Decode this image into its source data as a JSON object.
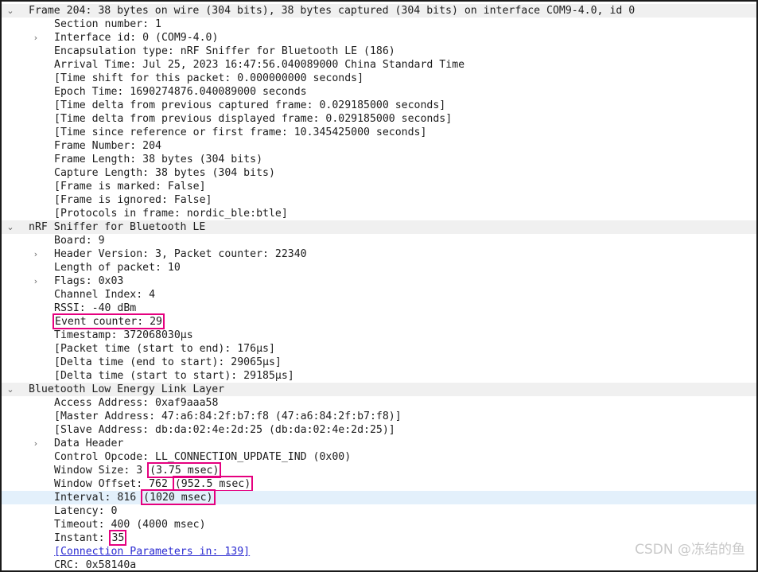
{
  "window": {
    "title": "Wireshark packet details pane"
  },
  "icons": {
    "expanded": "⌄",
    "collapsed": "›"
  },
  "watermark": "CSDN @冻结的鱼",
  "colors": {
    "annotation": "#e5007f",
    "selected_row": "#e3f0fb",
    "protocol_row": "#f0f0f0",
    "link": "#2b2bd1",
    "text": "#1c1c1c"
  },
  "rows": [
    {
      "text": "Frame 204: 38 bytes on wire (304 bits), 38 bytes captured (304 bits) on interface COM9-4.0, id 0",
      "level": 0,
      "twisty": "expanded",
      "style": "protocol",
      "name": "tree-row-frame"
    },
    {
      "text": "Section number: 1",
      "level": 1,
      "twisty": "none",
      "style": "normal",
      "name": "tree-row-section-number"
    },
    {
      "text": "Interface id: 0 (COM9-4.0)",
      "level": 1,
      "twisty": "collapsed",
      "style": "normal",
      "name": "tree-row-interface-id"
    },
    {
      "text": "Encapsulation type: nRF Sniffer for Bluetooth LE (186)",
      "level": 1,
      "twisty": "none",
      "style": "normal",
      "name": "tree-row-encapsulation-type"
    },
    {
      "text": "Arrival Time: Jul 25, 2023 16:47:56.040089000 China Standard Time",
      "level": 1,
      "twisty": "none",
      "style": "normal",
      "name": "tree-row-arrival-time"
    },
    {
      "text": "[Time shift for this packet: 0.000000000 seconds]",
      "level": 1,
      "twisty": "none",
      "style": "normal",
      "name": "tree-row-time-shift"
    },
    {
      "text": "Epoch Time: 1690274876.040089000 seconds",
      "level": 1,
      "twisty": "none",
      "style": "normal",
      "name": "tree-row-epoch-time"
    },
    {
      "text": "[Time delta from previous captured frame: 0.029185000 seconds]",
      "level": 1,
      "twisty": "none",
      "style": "normal",
      "name": "tree-row-time-delta-captured"
    },
    {
      "text": "[Time delta from previous displayed frame: 0.029185000 seconds]",
      "level": 1,
      "twisty": "none",
      "style": "normal",
      "name": "tree-row-time-delta-displayed"
    },
    {
      "text": "[Time since reference or first frame: 10.345425000 seconds]",
      "level": 1,
      "twisty": "none",
      "style": "normal",
      "name": "tree-row-time-since-reference"
    },
    {
      "text": "Frame Number: 204",
      "level": 1,
      "twisty": "none",
      "style": "normal",
      "name": "tree-row-frame-number"
    },
    {
      "text": "Frame Length: 38 bytes (304 bits)",
      "level": 1,
      "twisty": "none",
      "style": "normal",
      "name": "tree-row-frame-length"
    },
    {
      "text": "Capture Length: 38 bytes (304 bits)",
      "level": 1,
      "twisty": "none",
      "style": "normal",
      "name": "tree-row-capture-length"
    },
    {
      "text": "[Frame is marked: False]",
      "level": 1,
      "twisty": "none",
      "style": "normal",
      "name": "tree-row-frame-is-marked"
    },
    {
      "text": "[Frame is ignored: False]",
      "level": 1,
      "twisty": "none",
      "style": "normal",
      "name": "tree-row-frame-is-ignored"
    },
    {
      "text": "[Protocols in frame: nordic_ble:btle]",
      "level": 1,
      "twisty": "none",
      "style": "normal",
      "name": "tree-row-protocols-in-frame"
    },
    {
      "text": "nRF Sniffer for Bluetooth LE",
      "level": 0,
      "twisty": "expanded",
      "style": "protocol",
      "name": "tree-row-nrf-sniffer"
    },
    {
      "text": "Board: 9",
      "level": 1,
      "twisty": "none",
      "style": "normal",
      "name": "tree-row-board"
    },
    {
      "text": "Header Version: 3, Packet counter: 22340",
      "level": 1,
      "twisty": "collapsed",
      "style": "normal",
      "name": "tree-row-header-version"
    },
    {
      "text": "Length of packet: 10",
      "level": 1,
      "twisty": "none",
      "style": "normal",
      "name": "tree-row-length-of-packet"
    },
    {
      "text": "Flags: 0x03",
      "level": 1,
      "twisty": "collapsed",
      "style": "normal",
      "name": "tree-row-flags"
    },
    {
      "text": "Channel Index: 4",
      "level": 1,
      "twisty": "none",
      "style": "normal",
      "name": "tree-row-channel-index"
    },
    {
      "text": "RSSI: -40 dBm",
      "level": 1,
      "twisty": "none",
      "style": "normal",
      "name": "tree-row-rssi"
    },
    {
      "prefix": "",
      "boxed": "Event counter: 29",
      "suffix": "",
      "level": 1,
      "twisty": "none",
      "style": "normal",
      "name": "tree-row-event-counter"
    },
    {
      "text": "Timestamp: 372068030µs",
      "level": 1,
      "twisty": "none",
      "style": "normal",
      "name": "tree-row-timestamp"
    },
    {
      "text": "[Packet time (start to end): 176µs]",
      "level": 1,
      "twisty": "none",
      "style": "normal",
      "name": "tree-row-packet-time"
    },
    {
      "text": "[Delta time (end to start): 29065µs]",
      "level": 1,
      "twisty": "none",
      "style": "normal",
      "name": "tree-row-delta-time-end-start"
    },
    {
      "text": "[Delta time (start to start): 29185µs]",
      "level": 1,
      "twisty": "none",
      "style": "normal",
      "name": "tree-row-delta-time-start-start"
    },
    {
      "text": "Bluetooth Low Energy Link Layer",
      "level": 0,
      "twisty": "expanded",
      "style": "protocol",
      "name": "tree-row-btle-link-layer"
    },
    {
      "text": "Access Address: 0xaf9aaa58",
      "level": 1,
      "twisty": "none",
      "style": "normal",
      "name": "tree-row-access-address"
    },
    {
      "text": "[Master Address: 47:a6:84:2f:b7:f8 (47:a6:84:2f:b7:f8)]",
      "level": 1,
      "twisty": "none",
      "style": "normal",
      "name": "tree-row-master-address"
    },
    {
      "text": "[Slave Address: db:da:02:4e:2d:25 (db:da:02:4e:2d:25)]",
      "level": 1,
      "twisty": "none",
      "style": "normal",
      "name": "tree-row-slave-address"
    },
    {
      "text": "Data Header",
      "level": 1,
      "twisty": "collapsed",
      "style": "normal",
      "name": "tree-row-data-header"
    },
    {
      "text": "Control Opcode: LL_CONNECTION_UPDATE_IND (0x00)",
      "level": 1,
      "twisty": "none",
      "style": "normal",
      "name": "tree-row-control-opcode"
    },
    {
      "prefix": "Window Size: 3 ",
      "boxed": "(3.75 msec)",
      "suffix": "",
      "level": 1,
      "twisty": "none",
      "style": "normal",
      "name": "tree-row-window-size"
    },
    {
      "prefix": "Window Offset: 762 ",
      "boxed": "(952.5 msec)",
      "suffix": "",
      "level": 1,
      "twisty": "none",
      "style": "normal",
      "name": "tree-row-window-offset"
    },
    {
      "prefix": "Interval: 816 ",
      "boxed": "(1020 msec)",
      "suffix": "",
      "level": 1,
      "twisty": "none",
      "style": "selected",
      "name": "tree-row-interval"
    },
    {
      "text": "Latency: 0",
      "level": 1,
      "twisty": "none",
      "style": "normal",
      "name": "tree-row-latency"
    },
    {
      "text": "Timeout: 400 (4000 msec)",
      "level": 1,
      "twisty": "none",
      "style": "normal",
      "name": "tree-row-timeout"
    },
    {
      "prefix": "Instant: ",
      "boxed": "35",
      "suffix": "",
      "level": 1,
      "twisty": "none",
      "style": "normal",
      "name": "tree-row-instant"
    },
    {
      "text": "[Connection Parameters in: 139]",
      "level": 1,
      "twisty": "none",
      "style": "link",
      "name": "tree-row-connection-parameters-link"
    },
    {
      "text": "CRC: 0x58140a",
      "level": 1,
      "twisty": "none",
      "style": "normal",
      "name": "tree-row-crc"
    }
  ]
}
